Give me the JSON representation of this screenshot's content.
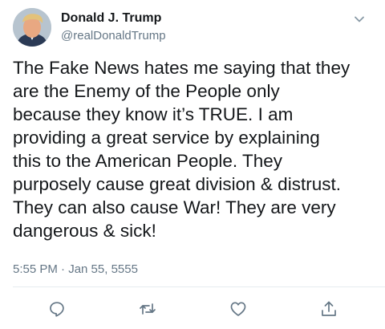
{
  "author": {
    "display_name": "Donald J. Trump",
    "handle": "@realDonaldTrump"
  },
  "tweet": {
    "text": "The Fake News hates me saying that they\nare the Enemy of the People only\nbecause they know it’s TRUE. I am\nproviding a great service by explaining\nthis to the American People. They\npurposely cause great division & distrust.\nThey can also cause War! They are very\ndangerous & sick!",
    "timestamp": "5:55 PM · Jan 55, 5555"
  },
  "icons": {
    "menu": "chevron-down-icon",
    "actions": [
      "reply-icon",
      "retweet-icon",
      "like-icon",
      "share-icon"
    ]
  },
  "colors": {
    "text": "#14171a",
    "secondary_text": "#657786",
    "icon": "#657786",
    "divider": "#e6ecf0"
  }
}
